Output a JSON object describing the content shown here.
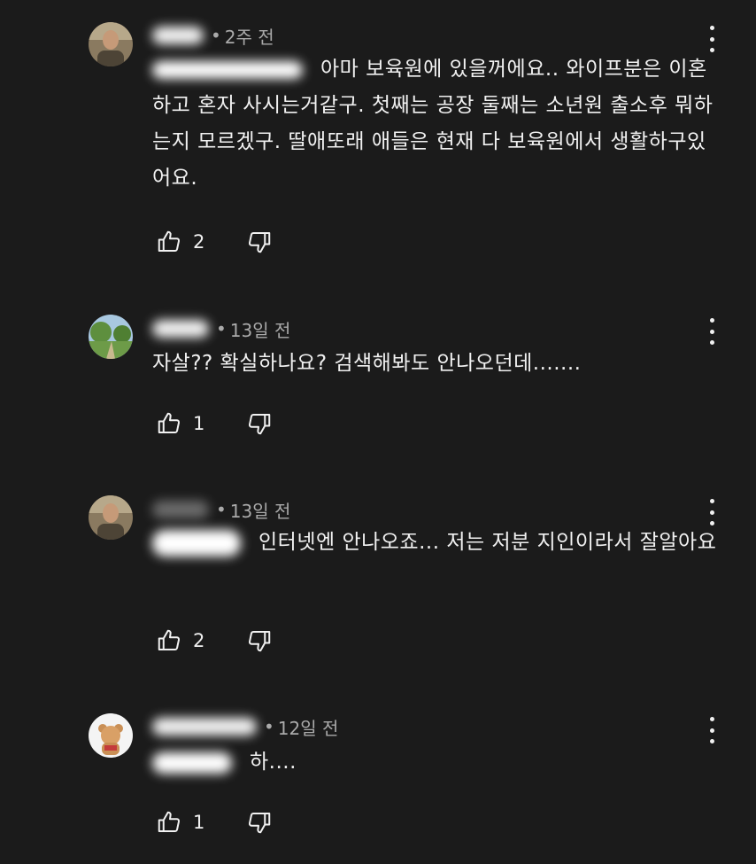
{
  "comments": [
    {
      "time": "2주 전",
      "text": "아마 보육원에 있을꺼에요.. 와이프분은 이혼하고 혼자 사시는거같구. 첫째는 공장 둘째는 소년원 출소후 뭐하는지 모르겠구. 딸애또래 애들은 현재 다 보육원에서 생활하구있어요.",
      "likes": "2",
      "avatar": "man-photo"
    },
    {
      "time": "13일 전",
      "text": "자살?? 확실하나요? 검색해봐도 안나오던데.......",
      "likes": "1",
      "avatar": "landscape-photo"
    },
    {
      "time": "13일 전",
      "text": "인터넷엔 안나오죠... 저는 저분 지인이라서 잘알아요",
      "likes": "2",
      "avatar": "man-photo"
    },
    {
      "time": "12일 전",
      "text": "하....",
      "likes": "1",
      "avatar": "bear-character"
    }
  ],
  "colors": {
    "background": "#1b1b1b",
    "text": "#f1f1f1",
    "meta": "#aaaaaa"
  }
}
